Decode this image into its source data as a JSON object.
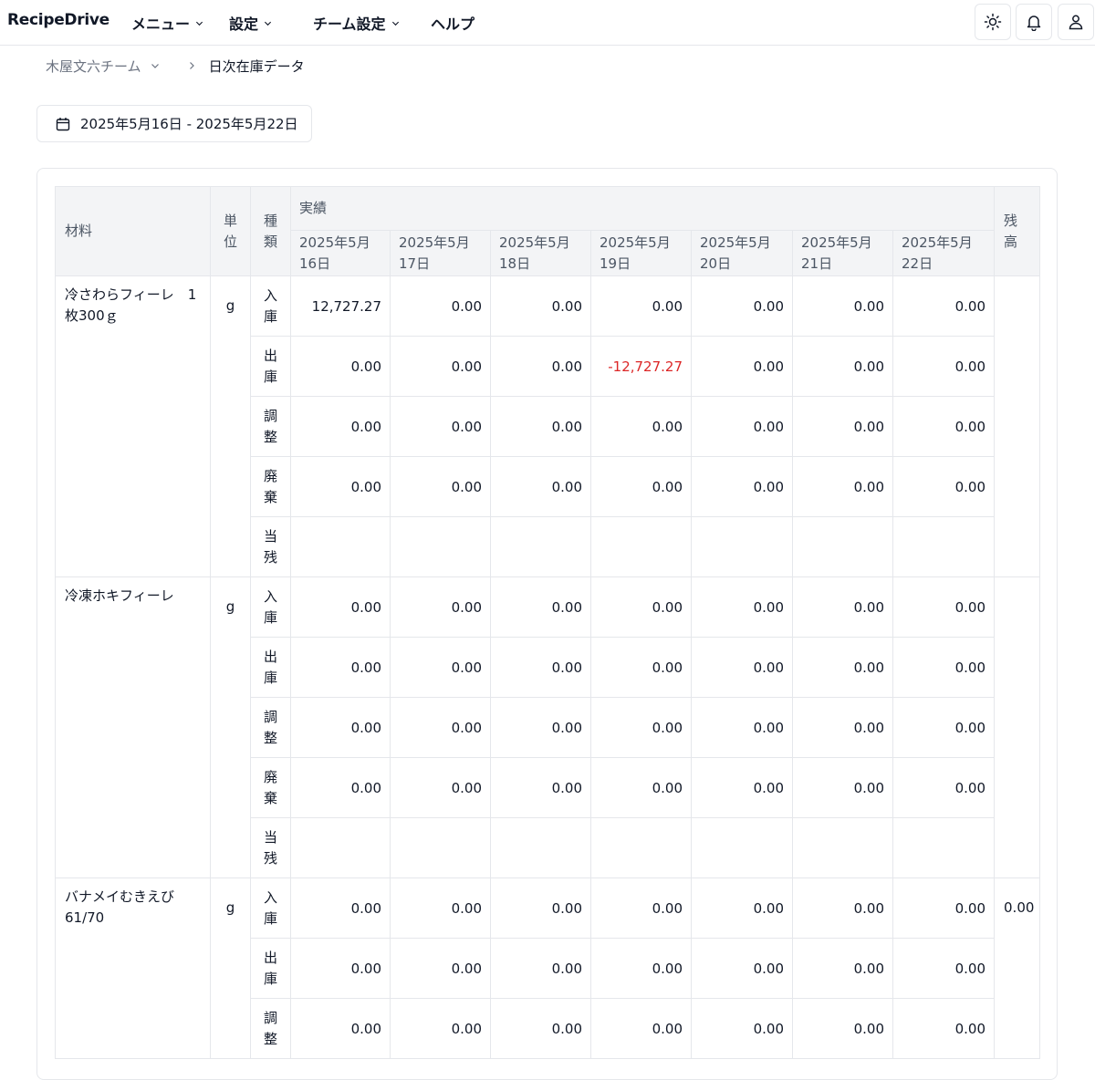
{
  "header": {
    "brand": "RecipeDrive",
    "nav": [
      {
        "label": "メニュー",
        "has_dropdown": true
      },
      {
        "label": "設定",
        "has_dropdown": true
      },
      {
        "label": "チーム設定",
        "has_dropdown": true
      },
      {
        "label": "ヘルプ",
        "has_dropdown": false
      }
    ],
    "icons": [
      "sun-icon",
      "bell-icon",
      "user-icon"
    ]
  },
  "breadcrumb": {
    "team": "木屋文六チーム",
    "current": "日次在庫データ"
  },
  "date_range": "2025年5月16日 - 2025年5月22日",
  "table": {
    "headers": {
      "material": "材料",
      "unit": "単位",
      "kind": "種類",
      "actual": "実績",
      "balance": "残高",
      "dates": [
        "2025年5月16日",
        "2025年5月17日",
        "2025年5月18日",
        "2025年5月19日",
        "2025年5月20日",
        "2025年5月21日",
        "2025年5月22日"
      ]
    },
    "materials": [
      {
        "name": "冷さわらフィーレ　1枚300ｇ",
        "unit": "g",
        "balance": "",
        "rows": [
          {
            "kind": "入庫",
            "values": [
              "12,727.27",
              "0.00",
              "0.00",
              "0.00",
              "0.00",
              "0.00",
              "0.00"
            ]
          },
          {
            "kind": "出庫",
            "values": [
              "0.00",
              "0.00",
              "0.00",
              "-12,727.27",
              "0.00",
              "0.00",
              "0.00"
            ]
          },
          {
            "kind": "調整",
            "values": [
              "0.00",
              "0.00",
              "0.00",
              "0.00",
              "0.00",
              "0.00",
              "0.00"
            ]
          },
          {
            "kind": "廃棄",
            "values": [
              "0.00",
              "0.00",
              "0.00",
              "0.00",
              "0.00",
              "0.00",
              "0.00"
            ]
          },
          {
            "kind": "当残",
            "values": [
              "",
              "",
              "",
              "",
              "",
              "",
              ""
            ]
          }
        ]
      },
      {
        "name": "冷凍ホキフィーレ",
        "unit": "g",
        "balance": "",
        "rows": [
          {
            "kind": "入庫",
            "values": [
              "0.00",
              "0.00",
              "0.00",
              "0.00",
              "0.00",
              "0.00",
              "0.00"
            ]
          },
          {
            "kind": "出庫",
            "values": [
              "0.00",
              "0.00",
              "0.00",
              "0.00",
              "0.00",
              "0.00",
              "0.00"
            ]
          },
          {
            "kind": "調整",
            "values": [
              "0.00",
              "0.00",
              "0.00",
              "0.00",
              "0.00",
              "0.00",
              "0.00"
            ]
          },
          {
            "kind": "廃棄",
            "values": [
              "0.00",
              "0.00",
              "0.00",
              "0.00",
              "0.00",
              "0.00",
              "0.00"
            ]
          },
          {
            "kind": "当残",
            "values": [
              "",
              "",
              "",
              "",
              "",
              "",
              ""
            ]
          }
        ]
      },
      {
        "name": "バナメイむきえび61/70",
        "unit": "g",
        "balance": "0.00",
        "rows": [
          {
            "kind": "入庫",
            "values": [
              "0.00",
              "0.00",
              "0.00",
              "0.00",
              "0.00",
              "0.00",
              "0.00"
            ]
          },
          {
            "kind": "出庫",
            "values": [
              "0.00",
              "0.00",
              "0.00",
              "0.00",
              "0.00",
              "0.00",
              "0.00"
            ]
          },
          {
            "kind": "調整",
            "values": [
              "0.00",
              "0.00",
              "0.00",
              "0.00",
              "0.00",
              "0.00",
              "0.00"
            ]
          }
        ]
      }
    ]
  },
  "colors": {
    "negative": "#dc2626",
    "header_bg": "#f3f4f6",
    "border": "#e5e7eb"
  }
}
